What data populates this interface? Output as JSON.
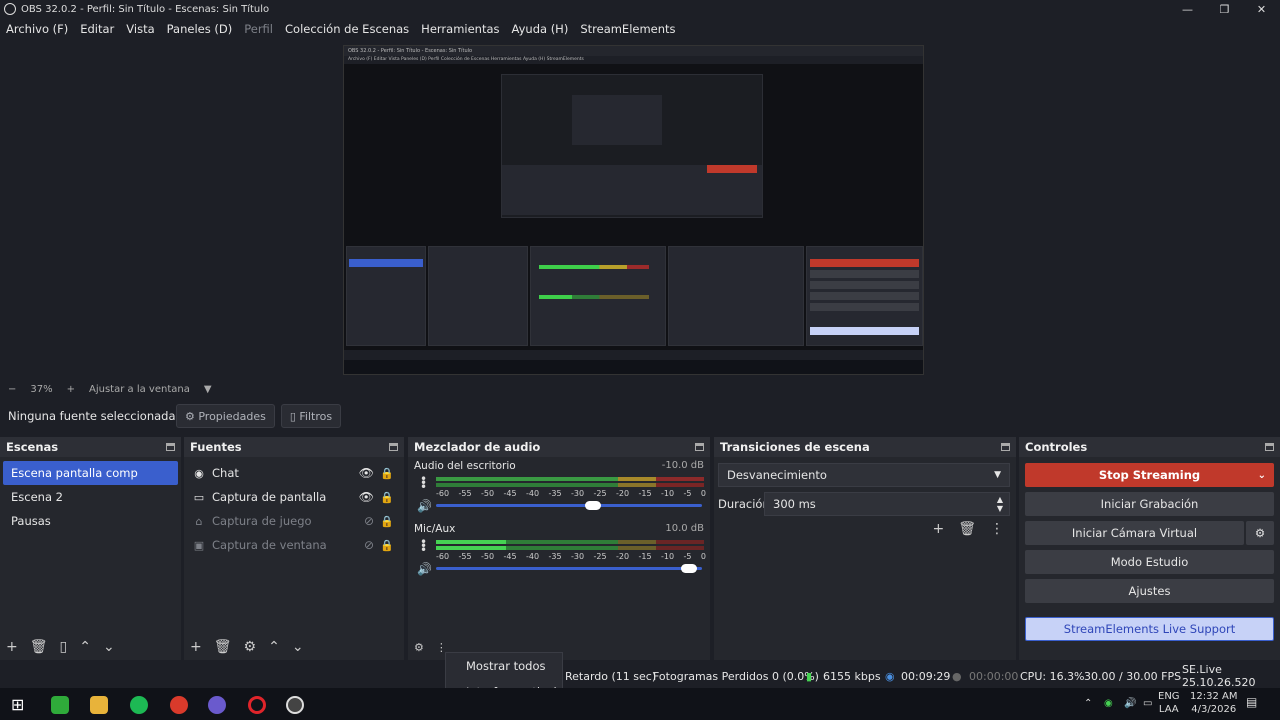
{
  "window": {
    "title": "OBS 32.0.2 - Perfil: Sin Título - Escenas: Sin Título"
  },
  "menu": [
    "Archivo (F)",
    "Editar",
    "Vista",
    "Paneles (D)",
    "Perfil",
    "Colección de Escenas",
    "Herramientas",
    "Ayuda (H)",
    "StreamElements"
  ],
  "zoom": {
    "value": "37%",
    "fit_label": "Ajustar a la ventana"
  },
  "source_toolbar": {
    "no_source": "Ninguna fuente seleccionada",
    "properties": "Propiedades",
    "filters": "Filtros"
  },
  "scenes": {
    "title": "Escenas",
    "items": [
      "Escena pantalla comp",
      "Escena 2",
      "Pausas"
    ]
  },
  "sources": {
    "title": "Fuentes",
    "items": [
      "Chat",
      "Captura de pantalla",
      "Captura de juego",
      "Captura de ventana"
    ]
  },
  "mixer": {
    "title": "Mezclador de audio",
    "channels": [
      {
        "name": "Audio del escritorio",
        "db": "-10.0 dB",
        "volume": 0.62
      },
      {
        "name": "Mic/Aux",
        "db": "10.0 dB",
        "volume": 0.98
      }
    ],
    "ticks": [
      "-60",
      "-55",
      "-50",
      "-45",
      "-40",
      "-35",
      "-30",
      "-25",
      "-20",
      "-15",
      "-10",
      "-5",
      "0"
    ]
  },
  "transitions": {
    "title": "Transiciones de escena",
    "type": "Desvanecimiento",
    "duration_label": "Duración",
    "duration_value": "300 ms"
  },
  "controls": {
    "title": "Controles",
    "stream": "Stop Streaming",
    "record": "Iniciar Grabación",
    "virtual_cam": "Iniciar Cámara Virtual",
    "studio": "Modo Estudio",
    "settings": "Ajustes",
    "support": "StreamElements Live Support"
  },
  "popup": {
    "show_all": "Mostrar todos",
    "vertical": "Interfaz vertical"
  },
  "status": {
    "delay": "Retardo (11 sec)",
    "dropped": "Fotogramas Perdidos 0 (0.0%)",
    "bitrate": "6155 kbps",
    "stream_time": "00:09:29",
    "rec_time": "00:00:00",
    "cpu": "CPU: 16.3%",
    "fps": "30.00 / 30.00 FPS",
    "se": "SE.Live 25.10.26.520"
  },
  "tray": {
    "lang1": "ENG",
    "lang2": "LAA",
    "time": "12:32 AM",
    "date": "4/3/2026"
  },
  "preview_mini": {
    "title": "OBS 32.0.2 - Perfil: Sin Título - Escenas: Sin Título",
    "menu": "Archivo (F)  Editar  Vista  Paneles (D)  Perfil  Colección de Escenas  Herramientas  Ayuda (H)  StreamElements"
  }
}
